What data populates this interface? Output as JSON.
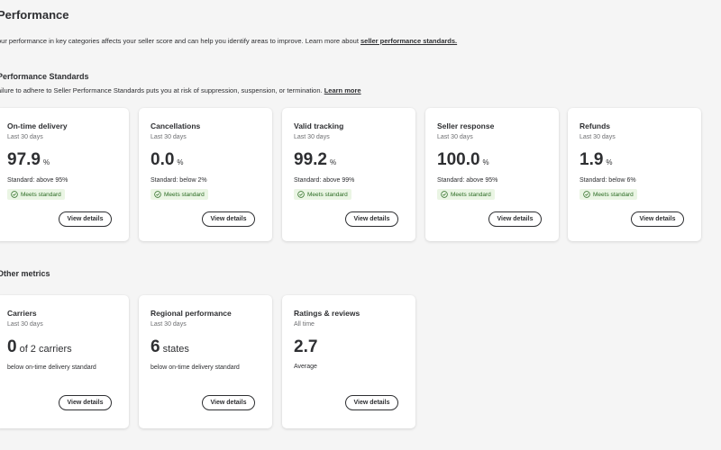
{
  "header": {
    "title": "Performance",
    "intro_text": "our performance in key categories affects your seller score and can help you identify areas to improve. Learn more about ",
    "intro_link": "seller performance standards."
  },
  "standards": {
    "title": "Performance Standards",
    "subtitle": "ailure to adhere to Seller Performance Standards puts you at risk of suppression, suspension, or termination.",
    "learn_more": "Learn more",
    "cards": [
      {
        "title": "On-time delivery",
        "period": "Last 30 days",
        "value": "97.9",
        "unit": "%",
        "standard": "Standard: above 95%",
        "status": "Meets standard",
        "button": "View details"
      },
      {
        "title": "Cancellations",
        "period": "Last 30 days",
        "value": "0.0",
        "unit": "%",
        "standard": "Standard: below 2%",
        "status": "Meets standard",
        "button": "View details"
      },
      {
        "title": "Valid tracking",
        "period": "Last 30 days",
        "value": "99.2",
        "unit": "%",
        "standard": "Standard: above 99%",
        "status": "Meets standard",
        "button": "View details"
      },
      {
        "title": "Seller response",
        "period": "Last 30 days",
        "value": "100.0",
        "unit": "%",
        "standard": "Standard: above 95%",
        "status": "Meets standard",
        "button": "View details"
      },
      {
        "title": "Refunds",
        "period": "Last 30 days",
        "value": "1.9",
        "unit": "%",
        "standard": "Standard: below 6%",
        "status": "Meets standard",
        "button": "View details"
      }
    ]
  },
  "other_metrics": {
    "title": "Other metrics",
    "cards": [
      {
        "title": "Carriers",
        "period": "Last 30 days",
        "value": "0",
        "unit": "of 2 carriers",
        "description": "below on-time delivery standard",
        "button": "View details"
      },
      {
        "title": "Regional performance",
        "period": "Last 30 days",
        "value": "6",
        "unit": "states",
        "description": "below on-time delivery standard",
        "button": "View details"
      },
      {
        "title": "Ratings & reviews",
        "period": "All time",
        "value": "2.7",
        "unit": "",
        "description": "Average",
        "button": "View details"
      }
    ]
  },
  "colors": {
    "badge_bg": "#eaf5e4",
    "badge_text": "#2a6b22",
    "text": "#2e2f32",
    "background": "#f5f5f5"
  },
  "icons": {
    "status": "check-circle-icon"
  }
}
